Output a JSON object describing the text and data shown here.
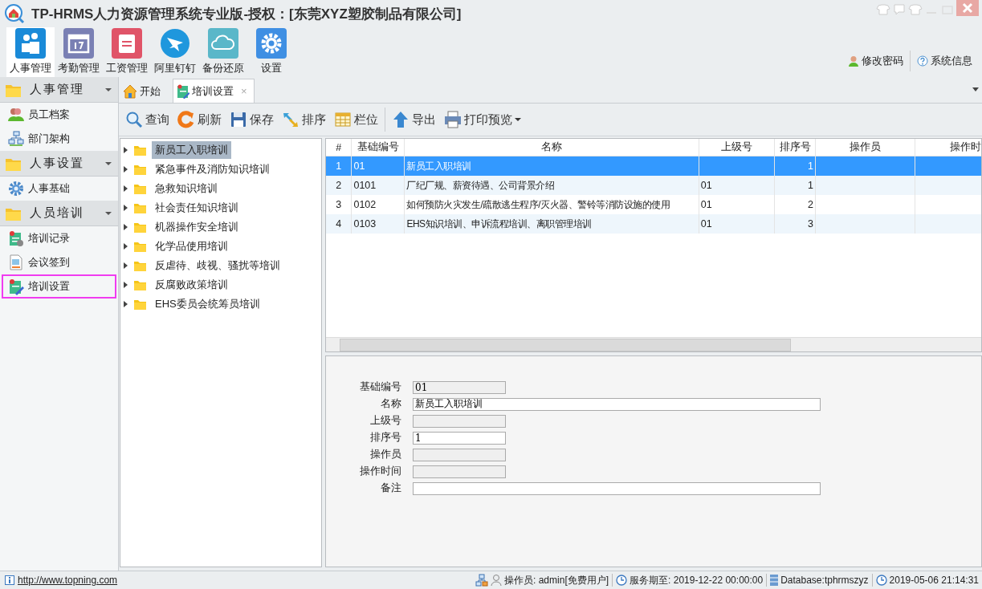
{
  "window": {
    "title": "TP-HRMS人力资源管理系统专业版-授权：[东莞XYZ塑胶制品有限公司]"
  },
  "modules": [
    {
      "label": "人事管理",
      "selected": true
    },
    {
      "label": "考勤管理",
      "selected": false
    },
    {
      "label": "工资管理",
      "selected": false
    },
    {
      "label": "阿里钉钉",
      "selected": false
    },
    {
      "label": "备份还原",
      "selected": false
    },
    {
      "label": "设置",
      "selected": false
    }
  ],
  "header_links": [
    "修改密码",
    "系统信息"
  ],
  "sidebar": {
    "groups": [
      {
        "label": "人事管理",
        "expanded": true,
        "items": [
          {
            "label": "员工档案",
            "selected": false
          },
          {
            "label": "部门架构",
            "selected": false
          }
        ]
      },
      {
        "label": "人事设置",
        "expanded": true,
        "items": [
          {
            "label": "人事基础",
            "selected": false
          }
        ]
      },
      {
        "label": "人员培训",
        "expanded": true,
        "items": [
          {
            "label": "培训记录",
            "selected": false
          },
          {
            "label": "会议签到",
            "selected": false
          },
          {
            "label": "培训设置",
            "selected": true
          }
        ]
      }
    ]
  },
  "tabs": [
    {
      "label": "开始",
      "selected": false,
      "closable": false
    },
    {
      "label": "培训设置",
      "selected": true,
      "closable": true,
      "close": "×"
    }
  ],
  "toolbar": [
    {
      "label": "查询",
      "dropdown": false
    },
    {
      "label": "刷新",
      "dropdown": false
    },
    {
      "label": "保存",
      "dropdown": false
    },
    {
      "label": "排序",
      "dropdown": false
    },
    {
      "label": "栏位",
      "dropdown": false
    },
    {
      "label": "导出",
      "dropdown": false
    },
    {
      "label": "打印预览",
      "dropdown": true
    }
  ],
  "tree": [
    {
      "label": "新员工入职培训",
      "selected": true
    },
    {
      "label": "紧急事件及消防知识培训",
      "selected": false
    },
    {
      "label": "急救知识培训",
      "selected": false
    },
    {
      "label": "社会责任知识培训",
      "selected": false
    },
    {
      "label": "机器操作安全培训",
      "selected": false
    },
    {
      "label": "化学品使用培训",
      "selected": false
    },
    {
      "label": "反虐待、歧视、骚扰等培训",
      "selected": false
    },
    {
      "label": "反腐败政策培训",
      "selected": false
    },
    {
      "label": "EHS委员会统筹员培训",
      "selected": false
    }
  ],
  "table": {
    "columns": [
      "#",
      "基础编号",
      "名称",
      "上级号",
      "排序号",
      "操作员",
      "操作时"
    ],
    "rows": [
      {
        "cells": [
          "1",
          "01",
          "新员工入职培训",
          "",
          "1",
          "",
          ""
        ],
        "selected": true
      },
      {
        "cells": [
          "2",
          "0101",
          "厂纪厂规、薪资待遇、公司背景介绍",
          "01",
          "1",
          "",
          ""
        ],
        "selected": false
      },
      {
        "cells": [
          "3",
          "0102",
          "如何预防火灾发生/疏散逃生程序/灭火器、警铃等消防设施的使用",
          "01",
          "2",
          "",
          ""
        ],
        "selected": false
      },
      {
        "cells": [
          "4",
          "0103",
          "EHS知识培训、申诉流程培训、离职管理培训",
          "01",
          "3",
          "",
          ""
        ],
        "selected": false
      }
    ]
  },
  "form": [
    {
      "label": "基础编号",
      "value": "01",
      "readonly": true,
      "kind": "short"
    },
    {
      "label": "名称",
      "value": "新员工入职培训",
      "readonly": false,
      "kind": "wide"
    },
    {
      "label": "上级号",
      "readonly": true,
      "kind": "short"
    },
    {
      "label": "排序号",
      "value": "1",
      "readonly": false,
      "kind": "short"
    },
    {
      "label": "操作员",
      "readonly": true,
      "kind": "short"
    },
    {
      "label": "操作时间",
      "readonly": true,
      "kind": "short"
    },
    {
      "label": "备注",
      "readonly": false,
      "kind": "wide"
    }
  ],
  "status_bar": {
    "link": "http://www.topning.com",
    "operator": "操作员: admin[免费用户]",
    "service": "服务期至: 2019-12-22 00:00:00",
    "database": "Database:tphrmszyz",
    "time": "2019-05-06 21:14:31"
  }
}
